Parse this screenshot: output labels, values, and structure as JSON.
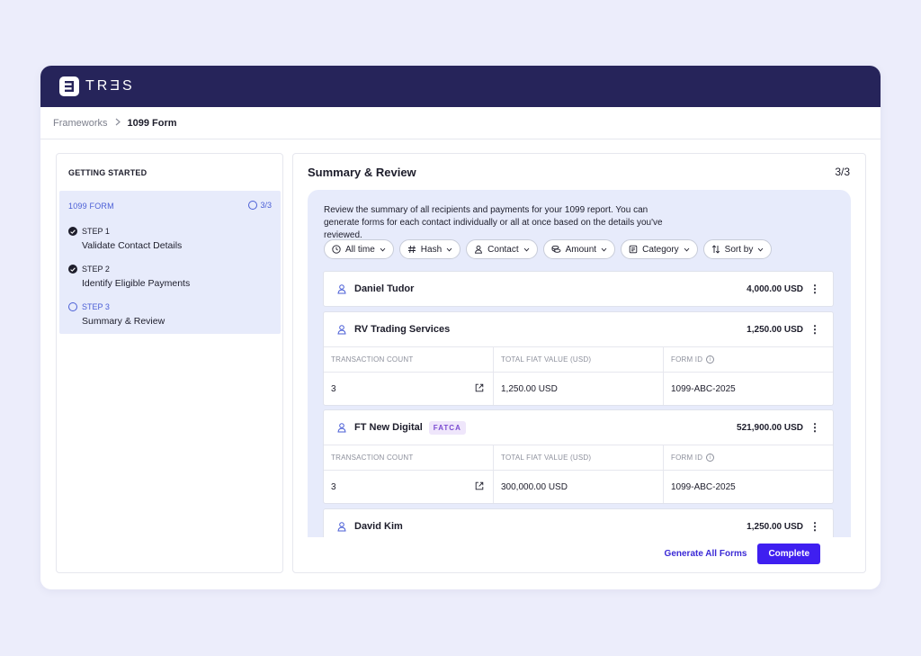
{
  "app": {
    "logo_text": "TRƎS"
  },
  "breadcrumb": {
    "parent": "Frameworks",
    "current": "1099 Form"
  },
  "sidebar": {
    "heading": "GETTING STARTED",
    "form_title": "1099 FORM",
    "progress": "3/3",
    "steps": [
      {
        "label": "STEP 1",
        "title": "Validate Contact Details",
        "status": "complete"
      },
      {
        "label": "STEP 2",
        "title": "Identify Eligible Payments",
        "status": "complete"
      },
      {
        "label": "STEP 3",
        "title": "Summary & Review",
        "status": "current"
      }
    ]
  },
  "main": {
    "title": "Summary & Review",
    "step_indicator": "3/3",
    "description": "Review the summary of all recipients and payments for your 1099 report. You can generate forms for each contact individually or all at once based on the details you've reviewed.",
    "filters": [
      "All time",
      "Hash",
      "Contact",
      "Amount",
      "Category",
      "Sort by"
    ],
    "table_headers": {
      "count": "TRANSACTION COUNT",
      "fiat": "TOTAL FIAT VALUE (USD)",
      "form_id": "FORM ID"
    },
    "recipients": [
      {
        "name": "Daniel Tudor",
        "amount": "4,000.00 USD"
      },
      {
        "name": "RV Trading Services",
        "amount": "1,250.00 USD",
        "transaction_count": "3",
        "fiat_value": "1,250.00 USD",
        "form_id": "1099-ABC-2025"
      },
      {
        "name": "FT New Digital",
        "badge": "FATCA",
        "amount": "521,900.00 USD",
        "transaction_count": "3",
        "fiat_value": "300,000.00 USD",
        "form_id": "1099-ABC-2025"
      },
      {
        "name": "David Kim",
        "amount": "1,250.00 USD"
      }
    ],
    "actions": {
      "generate_all": "Generate All Forms",
      "complete": "Complete"
    }
  },
  "colors": {
    "header_bg": "#26245a",
    "accent": "#3f1ff0",
    "step_accent": "#4a5ed6",
    "badge_bg": "#efe6fb",
    "badge_text": "#7a4bd1"
  }
}
